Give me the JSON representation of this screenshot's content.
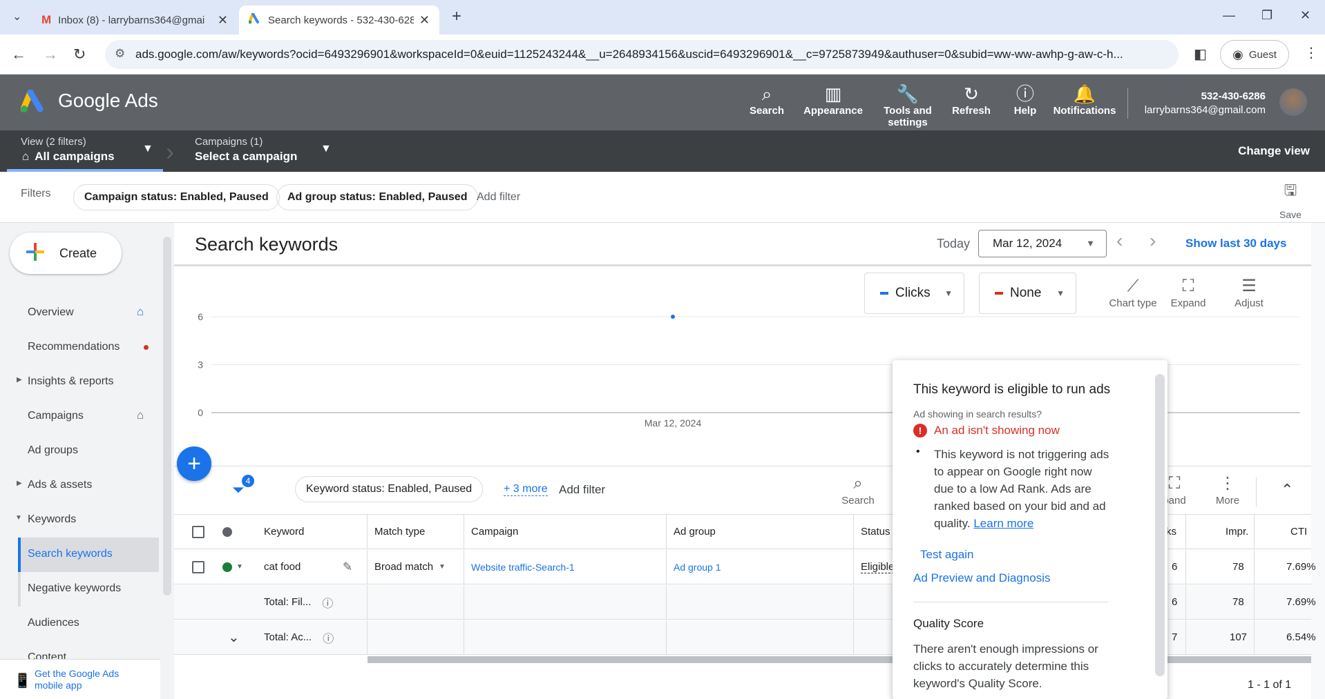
{
  "browser": {
    "tabs": [
      {
        "title": "Inbox (8) - larrybarns364@gmai"
      },
      {
        "title": "Search keywords - 532-430-628"
      }
    ],
    "url": "ads.google.com/aw/keywords?ocid=6493296901&workspaceId=0&euid=1125243244&__u=2648934156&uscid=6493296901&__c=9725873949&authuser=0&subid=ww-ww-awhp-g-aw-c-h...",
    "profile_label": "Guest"
  },
  "header": {
    "logo_text": "Google Ads",
    "buttons": [
      {
        "label": "Search"
      },
      {
        "label": "Appearance"
      },
      {
        "label": "Tools and settings"
      },
      {
        "label": "Refresh"
      },
      {
        "label": "Help"
      },
      {
        "label": "Notifications"
      }
    ],
    "account_id": "532-430-6286",
    "account_email": "larrybarns364@gmail.com"
  },
  "viewbar": {
    "view_label": "View (2 filters)",
    "view_value": "All campaigns",
    "campaigns_label": "Campaigns (1)",
    "campaigns_value": "Select a campaign",
    "change_view": "Change view"
  },
  "filters": {
    "label": "Filters",
    "chips": [
      "Campaign status: Enabled, Paused",
      "Ad group status: Enabled, Paused"
    ],
    "add_filter": "Add filter",
    "save": "Save"
  },
  "sidebar": {
    "create": "Create",
    "items": [
      {
        "label": "Overview"
      },
      {
        "label": "Recommendations"
      },
      {
        "label": "Insights & reports"
      },
      {
        "label": "Campaigns"
      },
      {
        "label": "Ad groups"
      },
      {
        "label": "Ads & assets"
      },
      {
        "label": "Keywords"
      },
      {
        "label": "Search keywords"
      },
      {
        "label": "Negative keywords"
      },
      {
        "label": "Audiences"
      },
      {
        "label": "Content"
      }
    ],
    "mobile_app": "Get the Google Ads mobile app"
  },
  "main": {
    "title": "Search keywords",
    "today_label": "Today",
    "date": "Mar 12, 2024",
    "show_last": "Show last 30 days",
    "metric1": "Clicks",
    "metric2": "None",
    "chart_tools": [
      {
        "label": "Chart type"
      },
      {
        "label": "Expand"
      },
      {
        "label": "Adjust"
      }
    ]
  },
  "chart_data": {
    "type": "line",
    "x": [
      "Mar 12, 2024"
    ],
    "series": [
      {
        "values": [
          6
        ]
      }
    ],
    "yticks": [
      0,
      3,
      6
    ],
    "ylim": [
      0,
      6
    ],
    "grid": true,
    "colors": {
      "series": "#1a73e8"
    }
  },
  "table_toolbar": {
    "filter_count": "4",
    "chip": "Keyword status: Enabled, Paused",
    "more": "+ 3 more",
    "add_filter": "Add filter",
    "search": "Search",
    "expand": "pand",
    "more_btn": "More"
  },
  "table": {
    "headers": {
      "keyword": "Keyword",
      "match_type": "Match type",
      "campaign": "Campaign",
      "ad_group": "Ad group",
      "status": "Status",
      "clicks": "ks",
      "impr": "Impr.",
      "ctr": "CTI"
    },
    "rows": [
      {
        "keyword": "cat food",
        "match_type": "Broad match",
        "campaign": "Website traffic-Search-1",
        "ad_group": "Ad group 1",
        "status": "Eligible",
        "clicks": "6",
        "impr": "78",
        "ctr": "7.69%"
      }
    ],
    "totals": [
      {
        "label": "Total: Fil...",
        "clicks": "6",
        "impr": "78",
        "ctr": "7.69%"
      },
      {
        "label": "Total: Ac...",
        "clicks": "7",
        "impr": "107",
        "ctr": "6.54%"
      }
    ],
    "pagination": "1 - 1 of 1"
  },
  "popover": {
    "title": "This keyword is eligible to run ads",
    "subtitle": "Ad showing in search results?",
    "error": "An ad isn't showing now",
    "bullet": "This keyword is not triggering ads to appear on Google right now due to a low Ad Rank. Ads are ranked based on your bid and ad quality.",
    "learn_more": "Learn more",
    "test_again": "Test again",
    "preview": "Ad Preview and Diagnosis",
    "qs_title": "Quality Score",
    "qs_text": "There aren't enough impressions or clicks to accurately determine this keyword's Quality Score."
  }
}
